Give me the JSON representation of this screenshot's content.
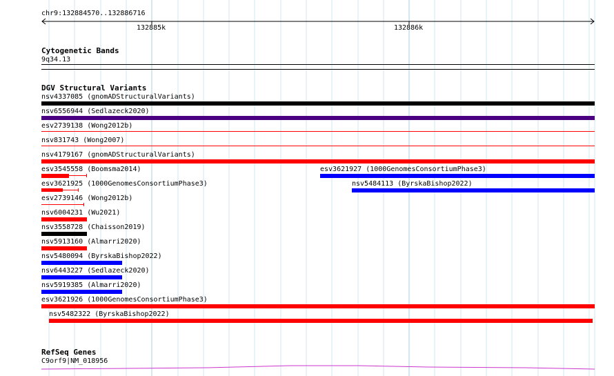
{
  "ruler": {
    "range_label": "chr9:132884570..132886716",
    "tick_labels": [
      "132885k",
      "132886k"
    ]
  },
  "cytoband": {
    "title": "Cytogenetic Bands",
    "band": "9q34.13"
  },
  "dgv": {
    "title": "DGV Structural Variants",
    "features": [
      {
        "label": "nsv4337085 (gnomADStructuralVariants)",
        "color": "#000000"
      },
      {
        "label": "nsv6556944 (Sedlazeck2020)",
        "color": "#4b0082"
      },
      {
        "label": "esv2739138 (Wong2012b)",
        "color": "#ff0000"
      },
      {
        "label": "nsv831743 (Wong2007)",
        "color": "#ff0000"
      },
      {
        "label": "nsv4179167 (gnomADStructuralVariants)",
        "color": "#ff0000"
      },
      {
        "label": "esv3545558 (Boomsma2014)",
        "color": "#ff0000"
      },
      {
        "label": "esv3621927 (1000GenomesConsortiumPhase3)",
        "color": "#0000ff"
      },
      {
        "label": "esv3621925 (1000GenomesConsortiumPhase3)",
        "color": "#ff0000"
      },
      {
        "label": "nsv5484113 (ByrskaBishop2022)",
        "color": "#0000ff"
      },
      {
        "label": "esv2739146 (Wong2012b)",
        "color": "#ff0000"
      },
      {
        "label": "nsv6004231 (Wu2021)",
        "color": "#ff0000"
      },
      {
        "label": "nsv3558728 (Chaisson2019)",
        "color": "#000000"
      },
      {
        "label": "nsv5913160 (Almarri2020)",
        "color": "#ff0000"
      },
      {
        "label": "nsv5480094 (ByrskaBishop2022)",
        "color": "#0000ff"
      },
      {
        "label": "nsv6443227 (Sedlazeck2020)",
        "color": "#0000ff"
      },
      {
        "label": "nsv5919385 (Almarri2020)",
        "color": "#0000ff"
      },
      {
        "label": "esv3621926 (1000GenomesConsortiumPhase3)",
        "color": "#ff0000"
      },
      {
        "label": "nsv5482322 (ByrskaBishop2022)",
        "color": "#ff0000"
      }
    ]
  },
  "refseq": {
    "title": "RefSeq Genes",
    "gene_label": "C9orf9|NM_018956",
    "color": "#cc33cc"
  }
}
